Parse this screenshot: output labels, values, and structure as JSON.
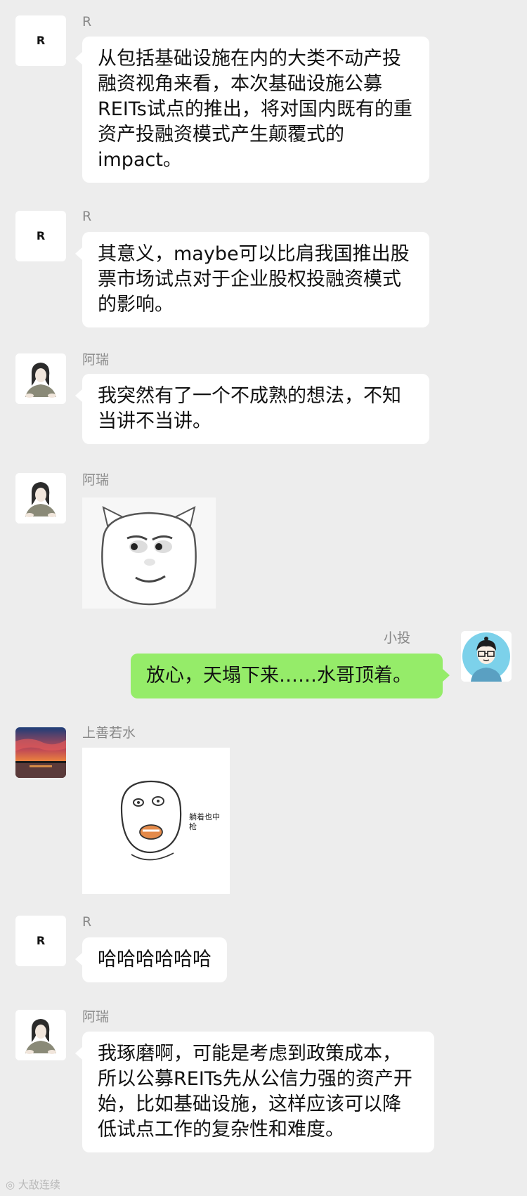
{
  "messages": [
    {
      "sender": "R",
      "avatar": "R",
      "text": "从包括基础设施在内的大类不动产投融资视角来看，本次基础设施公募REITs试点的推出，将对国内既有的重资产投融资模式产生颠覆式的impact。"
    },
    {
      "sender": "R",
      "avatar": "R",
      "text": "其意义，maybe可以比肩我国推出股票市场试点对于企业股权投融资模式的影响。"
    },
    {
      "sender": "阿瑞",
      "text": "我突然有了一个不成熟的想法，不知当讲不当讲。"
    },
    {
      "sender": "阿瑞",
      "sticker": "smirking-pig-face-sticker"
    },
    {
      "sender": "小投",
      "text": "放心，天塌下来……水哥顶着。"
    },
    {
      "sender": "上善若水",
      "sticker": "shot-while-lying-down-sticker",
      "sticker_caption": "躺着也中枪"
    },
    {
      "sender": "R",
      "avatar": "R",
      "text": "哈哈哈哈哈哈"
    },
    {
      "sender": "阿瑞",
      "text": "我琢磨啊，可能是考虑到政策成本，所以公募REITs先从公信力强的资产开始，比如基础设施，这样应该可以降低试点工作的复杂性和难度。"
    }
  ],
  "watermark": "大敌连续",
  "colors": {
    "background": "#ededed",
    "incoming_bubble": "#ffffff",
    "outgoing_bubble": "#95ec69",
    "sender_name": "#888888"
  }
}
